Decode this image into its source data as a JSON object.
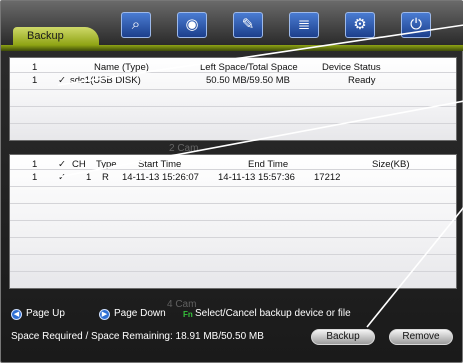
{
  "tab": {
    "label": "Backup"
  },
  "toolbar": {
    "icons": [
      "camera-search-icon",
      "disk-icon",
      "wrench-icon",
      "list-icon",
      "hdd-settings-icon",
      "power-icon"
    ]
  },
  "device_table": {
    "headers": {
      "index": "1",
      "name": "Name (Type)",
      "space": "Left Space/Total Space",
      "status": "Device Status"
    },
    "row": {
      "index": "1",
      "check": "✓",
      "name": "sdc1(USB DISK)",
      "space": "50.50 MB/59.50 MB",
      "status": "Ready"
    }
  },
  "file_table": {
    "headers": {
      "index": "1",
      "check": "✓",
      "ch": "CH",
      "type": "Type",
      "start": "Start Time",
      "end": "End Time",
      "size": "Size(KB)"
    },
    "row": {
      "index": "1",
      "check": "✓",
      "ch": "1",
      "type": "R",
      "start": "14-11-13 15:26:07",
      "end": "14-11-13 15:57:36",
      "size": "17212"
    }
  },
  "watermarks": {
    "cam2": "2  Cam",
    "cam4": "4  Cam"
  },
  "footer": {
    "page_up": "Page Up",
    "page_down": "Page Down",
    "fn_label": "Fn",
    "fn_hint": "Select/Cancel backup device or file",
    "space_text": "Space Required / Space Remaining: 18.91 MB/50.50 MB",
    "backup_button": "Backup",
    "remove_button": "Remove"
  },
  "colors": {
    "tab_green": "#a6b821",
    "button_blue": "#2f6fd3",
    "panel_bg": "#f2f2f4"
  }
}
